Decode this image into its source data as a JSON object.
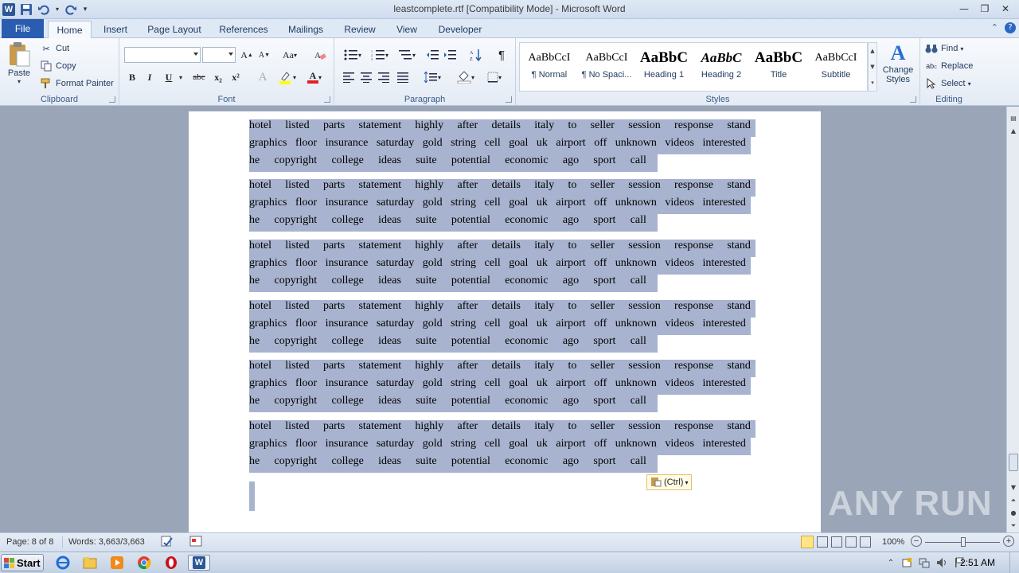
{
  "window": {
    "title": "leastcomplete.rtf [Compatibility Mode]  -  Microsoft Word"
  },
  "tabs": [
    "File",
    "Home",
    "Insert",
    "Page Layout",
    "References",
    "Mailings",
    "Review",
    "View",
    "Developer"
  ],
  "ribbon": {
    "clipboard": {
      "label": "Clipboard",
      "paste": "Paste",
      "cut": "Cut",
      "copy": "Copy",
      "format_painter": "Format Painter"
    },
    "font": {
      "label": "Font",
      "font_name": "",
      "font_size": "",
      "bold": "B",
      "italic": "I",
      "underline": "U",
      "strike": "abc",
      "subscript": "x₂",
      "superscript": "x²",
      "change_case": "Aa"
    },
    "paragraph": {
      "label": "Paragraph"
    },
    "styles": {
      "label": "Styles",
      "items": [
        {
          "preview": "AaBbCcI",
          "name": "¶ Normal"
        },
        {
          "preview": "AaBbCcI",
          "name": "¶ No Spaci..."
        },
        {
          "preview": "AaBbC",
          "name": "Heading 1"
        },
        {
          "preview": "AaBbC",
          "name": "Heading 2"
        },
        {
          "preview": "AaBbC",
          "name": "Title"
        },
        {
          "preview": "AaBbCcI",
          "name": "Subtitle"
        }
      ],
      "change_styles": "Change Styles"
    },
    "editing": {
      "label": "Editing",
      "find": "Find",
      "replace": "Replace",
      "select": "Select"
    }
  },
  "document": {
    "paragraph_lines": [
      [
        "hotel",
        "listed",
        "parts",
        "statement",
        "highly",
        "after",
        "details",
        "italy",
        "to",
        "seller",
        "session",
        "response",
        "stand"
      ],
      [
        "graphics",
        "floor",
        "insurance",
        "saturday",
        "gold",
        "string",
        "cell",
        "goal",
        "uk",
        "airport",
        "off",
        "unknown",
        "videos",
        "interested"
      ],
      [
        "he",
        "copyright",
        "college",
        "ideas",
        "suite",
        "potential",
        "economic",
        "ago",
        "sport",
        "call"
      ]
    ],
    "paragraph_count": 6,
    "paste_options": "(Ctrl)"
  },
  "statusbar": {
    "page": "Page: 8 of 8",
    "words": "Words: 3,663/3,663",
    "zoom": "100%"
  },
  "taskbar": {
    "start": "Start",
    "clock": "2:51 AM"
  },
  "watermark": "ANY RUN"
}
